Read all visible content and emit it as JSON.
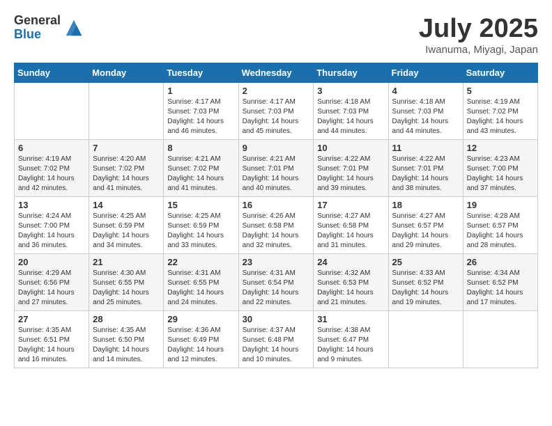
{
  "logo": {
    "general": "General",
    "blue": "Blue"
  },
  "title": "July 2025",
  "location": "Iwanuma, Miyagi, Japan",
  "days_of_week": [
    "Sunday",
    "Monday",
    "Tuesday",
    "Wednesday",
    "Thursday",
    "Friday",
    "Saturday"
  ],
  "weeks": [
    [
      {
        "day": "",
        "info": ""
      },
      {
        "day": "",
        "info": ""
      },
      {
        "day": "1",
        "info": "Sunrise: 4:17 AM\nSunset: 7:03 PM\nDaylight: 14 hours and 46 minutes."
      },
      {
        "day": "2",
        "info": "Sunrise: 4:17 AM\nSunset: 7:03 PM\nDaylight: 14 hours and 45 minutes."
      },
      {
        "day": "3",
        "info": "Sunrise: 4:18 AM\nSunset: 7:03 PM\nDaylight: 14 hours and 44 minutes."
      },
      {
        "day": "4",
        "info": "Sunrise: 4:18 AM\nSunset: 7:03 PM\nDaylight: 14 hours and 44 minutes."
      },
      {
        "day": "5",
        "info": "Sunrise: 4:19 AM\nSunset: 7:02 PM\nDaylight: 14 hours and 43 minutes."
      }
    ],
    [
      {
        "day": "6",
        "info": "Sunrise: 4:19 AM\nSunset: 7:02 PM\nDaylight: 14 hours and 42 minutes."
      },
      {
        "day": "7",
        "info": "Sunrise: 4:20 AM\nSunset: 7:02 PM\nDaylight: 14 hours and 41 minutes."
      },
      {
        "day": "8",
        "info": "Sunrise: 4:21 AM\nSunset: 7:02 PM\nDaylight: 14 hours and 41 minutes."
      },
      {
        "day": "9",
        "info": "Sunrise: 4:21 AM\nSunset: 7:01 PM\nDaylight: 14 hours and 40 minutes."
      },
      {
        "day": "10",
        "info": "Sunrise: 4:22 AM\nSunset: 7:01 PM\nDaylight: 14 hours and 39 minutes."
      },
      {
        "day": "11",
        "info": "Sunrise: 4:22 AM\nSunset: 7:01 PM\nDaylight: 14 hours and 38 minutes."
      },
      {
        "day": "12",
        "info": "Sunrise: 4:23 AM\nSunset: 7:00 PM\nDaylight: 14 hours and 37 minutes."
      }
    ],
    [
      {
        "day": "13",
        "info": "Sunrise: 4:24 AM\nSunset: 7:00 PM\nDaylight: 14 hours and 36 minutes."
      },
      {
        "day": "14",
        "info": "Sunrise: 4:25 AM\nSunset: 6:59 PM\nDaylight: 14 hours and 34 minutes."
      },
      {
        "day": "15",
        "info": "Sunrise: 4:25 AM\nSunset: 6:59 PM\nDaylight: 14 hours and 33 minutes."
      },
      {
        "day": "16",
        "info": "Sunrise: 4:26 AM\nSunset: 6:58 PM\nDaylight: 14 hours and 32 minutes."
      },
      {
        "day": "17",
        "info": "Sunrise: 4:27 AM\nSunset: 6:58 PM\nDaylight: 14 hours and 31 minutes."
      },
      {
        "day": "18",
        "info": "Sunrise: 4:27 AM\nSunset: 6:57 PM\nDaylight: 14 hours and 29 minutes."
      },
      {
        "day": "19",
        "info": "Sunrise: 4:28 AM\nSunset: 6:57 PM\nDaylight: 14 hours and 28 minutes."
      }
    ],
    [
      {
        "day": "20",
        "info": "Sunrise: 4:29 AM\nSunset: 6:56 PM\nDaylight: 14 hours and 27 minutes."
      },
      {
        "day": "21",
        "info": "Sunrise: 4:30 AM\nSunset: 6:55 PM\nDaylight: 14 hours and 25 minutes."
      },
      {
        "day": "22",
        "info": "Sunrise: 4:31 AM\nSunset: 6:55 PM\nDaylight: 14 hours and 24 minutes."
      },
      {
        "day": "23",
        "info": "Sunrise: 4:31 AM\nSunset: 6:54 PM\nDaylight: 14 hours and 22 minutes."
      },
      {
        "day": "24",
        "info": "Sunrise: 4:32 AM\nSunset: 6:53 PM\nDaylight: 14 hours and 21 minutes."
      },
      {
        "day": "25",
        "info": "Sunrise: 4:33 AM\nSunset: 6:52 PM\nDaylight: 14 hours and 19 minutes."
      },
      {
        "day": "26",
        "info": "Sunrise: 4:34 AM\nSunset: 6:52 PM\nDaylight: 14 hours and 17 minutes."
      }
    ],
    [
      {
        "day": "27",
        "info": "Sunrise: 4:35 AM\nSunset: 6:51 PM\nDaylight: 14 hours and 16 minutes."
      },
      {
        "day": "28",
        "info": "Sunrise: 4:35 AM\nSunset: 6:50 PM\nDaylight: 14 hours and 14 minutes."
      },
      {
        "day": "29",
        "info": "Sunrise: 4:36 AM\nSunset: 6:49 PM\nDaylight: 14 hours and 12 minutes."
      },
      {
        "day": "30",
        "info": "Sunrise: 4:37 AM\nSunset: 6:48 PM\nDaylight: 14 hours and 10 minutes."
      },
      {
        "day": "31",
        "info": "Sunrise: 4:38 AM\nSunset: 6:47 PM\nDaylight: 14 hours and 9 minutes."
      },
      {
        "day": "",
        "info": ""
      },
      {
        "day": "",
        "info": ""
      }
    ]
  ]
}
